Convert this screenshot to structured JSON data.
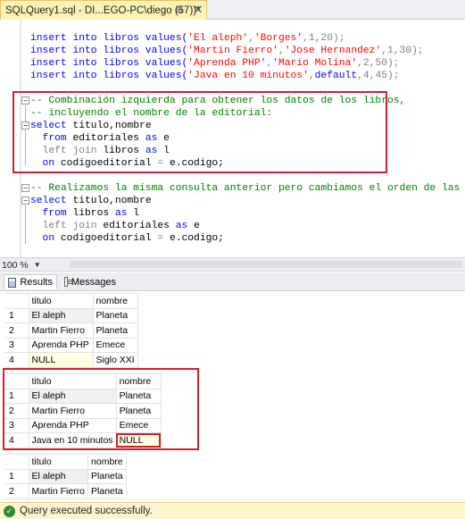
{
  "tab": {
    "title": "SQLQuery1.sql - DI...EGO-PC\\diego (57))*",
    "pin_icon": "pin-icon",
    "close_icon": "close-icon"
  },
  "editor": {
    "lines": [
      {
        "segments": [
          {
            "t": "insert into libros values(",
            "c": "kw"
          },
          {
            "t": "'El aleph'",
            "c": "str"
          },
          {
            "t": ",",
            "c": "gr"
          },
          {
            "t": "'Borges'",
            "c": "str"
          },
          {
            "t": ",1,20);",
            "c": "gr"
          }
        ]
      },
      {
        "segments": [
          {
            "t": "insert into libros values(",
            "c": "kw"
          },
          {
            "t": "'Martin Fierro'",
            "c": "str"
          },
          {
            "t": ",",
            "c": "gr"
          },
          {
            "t": "'Jose Hernandez'",
            "c": "str"
          },
          {
            "t": ",1,30);",
            "c": "gr"
          }
        ]
      },
      {
        "segments": [
          {
            "t": "insert into libros values(",
            "c": "kw"
          },
          {
            "t": "'Aprenda PHP'",
            "c": "str"
          },
          {
            "t": ",",
            "c": "gr"
          },
          {
            "t": "'Mario Molina'",
            "c": "str"
          },
          {
            "t": ",2,50);",
            "c": "gr"
          }
        ]
      },
      {
        "segments": [
          {
            "t": "insert into libros values(",
            "c": "kw"
          },
          {
            "t": "'Java en 10 minutos'",
            "c": "str"
          },
          {
            "t": ",",
            "c": "gr"
          },
          {
            "t": "default",
            "c": "kw"
          },
          {
            "t": ",4,45);",
            "c": "gr"
          }
        ]
      },
      {
        "segments": []
      },
      {
        "segments": [
          {
            "t": "-- Combinación izquierda para obtener los datos de los libros,",
            "c": "cm"
          }
        ]
      },
      {
        "segments": [
          {
            "t": "-- incluyendo el nombre de la editorial:",
            "c": "cm"
          }
        ]
      },
      {
        "segments": [
          {
            "t": "select ",
            "c": "kw"
          },
          {
            "t": "titulo,nombre",
            "c": "plain"
          }
        ]
      },
      {
        "segments": [
          {
            "t": "  from ",
            "c": "kw"
          },
          {
            "t": "editoriales ",
            "c": "plain"
          },
          {
            "t": "as ",
            "c": "kw"
          },
          {
            "t": "e",
            "c": "plain"
          }
        ]
      },
      {
        "segments": [
          {
            "t": "  left join ",
            "c": "gr"
          },
          {
            "t": "libros ",
            "c": "plain"
          },
          {
            "t": "as ",
            "c": "kw"
          },
          {
            "t": "l",
            "c": "plain"
          }
        ]
      },
      {
        "segments": [
          {
            "t": "  on ",
            "c": "kw"
          },
          {
            "t": "codigoeditorial ",
            "c": "plain"
          },
          {
            "t": "= ",
            "c": "gr"
          },
          {
            "t": "e.codigo;",
            "c": "plain"
          }
        ]
      },
      {
        "segments": []
      },
      {
        "segments": [
          {
            "t": "-- Realizamos la misma consulta anterior pero cambiamos el orden de las tablas:",
            "c": "cm"
          }
        ]
      },
      {
        "segments": [
          {
            "t": "select ",
            "c": "kw"
          },
          {
            "t": "titulo,nombre",
            "c": "plain"
          }
        ]
      },
      {
        "segments": [
          {
            "t": "  from ",
            "c": "kw"
          },
          {
            "t": "libros ",
            "c": "plain"
          },
          {
            "t": "as ",
            "c": "kw"
          },
          {
            "t": "l",
            "c": "plain"
          }
        ]
      },
      {
        "segments": [
          {
            "t": "  left join ",
            "c": "gr"
          },
          {
            "t": "editoriales ",
            "c": "plain"
          },
          {
            "t": "as ",
            "c": "kw"
          },
          {
            "t": "e",
            "c": "plain"
          }
        ]
      },
      {
        "segments": [
          {
            "t": "  on ",
            "c": "kw"
          },
          {
            "t": "codigoeditorial ",
            "c": "plain"
          },
          {
            "t": "= ",
            "c": "gr"
          },
          {
            "t": "e.codigo;",
            "c": "plain"
          }
        ]
      }
    ]
  },
  "zoom": {
    "value": "100 %"
  },
  "result_tabs": {
    "results": "Results",
    "messages": "Messages"
  },
  "grids": [
    {
      "headers": [
        "titulo",
        "nombre"
      ],
      "rows": [
        [
          "1",
          "El aleph",
          "Planeta"
        ],
        [
          "2",
          "Martin Fierro",
          "Planeta"
        ],
        [
          "3",
          "Aprenda PHP",
          "Emece"
        ],
        [
          "4",
          "NULL",
          "Siglo XXI"
        ]
      ]
    },
    {
      "headers": [
        "titulo",
        "nombre"
      ],
      "rows": [
        [
          "1",
          "El aleph",
          "Planeta"
        ],
        [
          "2",
          "Martin Fierro",
          "Planeta"
        ],
        [
          "3",
          "Aprenda PHP",
          "Emece"
        ],
        [
          "4",
          "Java en 10 minutos",
          "NULL"
        ]
      ]
    },
    {
      "headers": [
        "titulo",
        "nombre"
      ],
      "rows": [
        [
          "1",
          "El aleph",
          "Planeta"
        ],
        [
          "2",
          "Martin Fierro",
          "Planeta"
        ]
      ]
    }
  ],
  "status": {
    "text": "Query executed successfully."
  },
  "colors": {
    "keyword": "#0000ff",
    "string": "#ff0000",
    "comment": "#008000",
    "operator": "#808080",
    "highlight": "#d41f2b",
    "tab_active": "#fef2b4",
    "null_cell": "#ffffe1",
    "status_bar": "#fef4d0"
  }
}
